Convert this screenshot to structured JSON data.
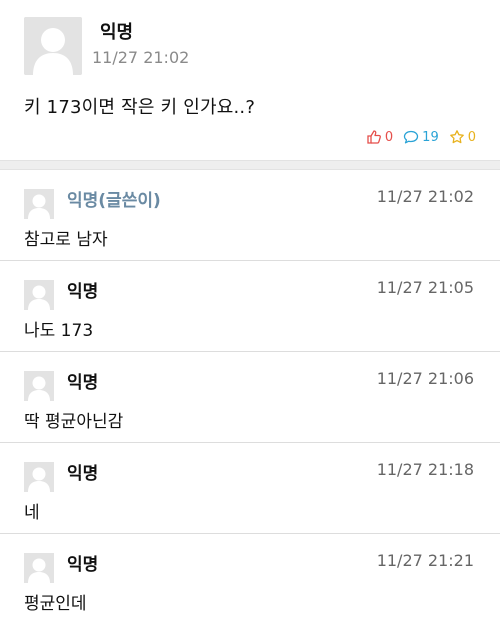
{
  "post": {
    "author": "익명",
    "time": "11/27 21:02",
    "body": "키 173이면 작은 키 인가요..?",
    "stats": {
      "likes": "0",
      "comments": "19",
      "scraps": "0"
    }
  },
  "comments": [
    {
      "author": "익명(글쓴이)",
      "time": "11/27 21:02",
      "text": "참고로 남자"
    },
    {
      "author": "익명",
      "time": "11/27 21:05",
      "text": "나도 173"
    },
    {
      "author": "익명",
      "time": "11/27 21:06",
      "text": "딱 평균아닌감"
    },
    {
      "author": "익명",
      "time": "11/27 21:18",
      "text": "네"
    },
    {
      "author": "익명",
      "time": "11/27 21:21",
      "text": "평균인데"
    }
  ],
  "colors": {
    "like": "#e54e4a",
    "comment": "#2aa3d6",
    "scrap": "#e8b21e",
    "op_author": "#6a8aa3"
  }
}
